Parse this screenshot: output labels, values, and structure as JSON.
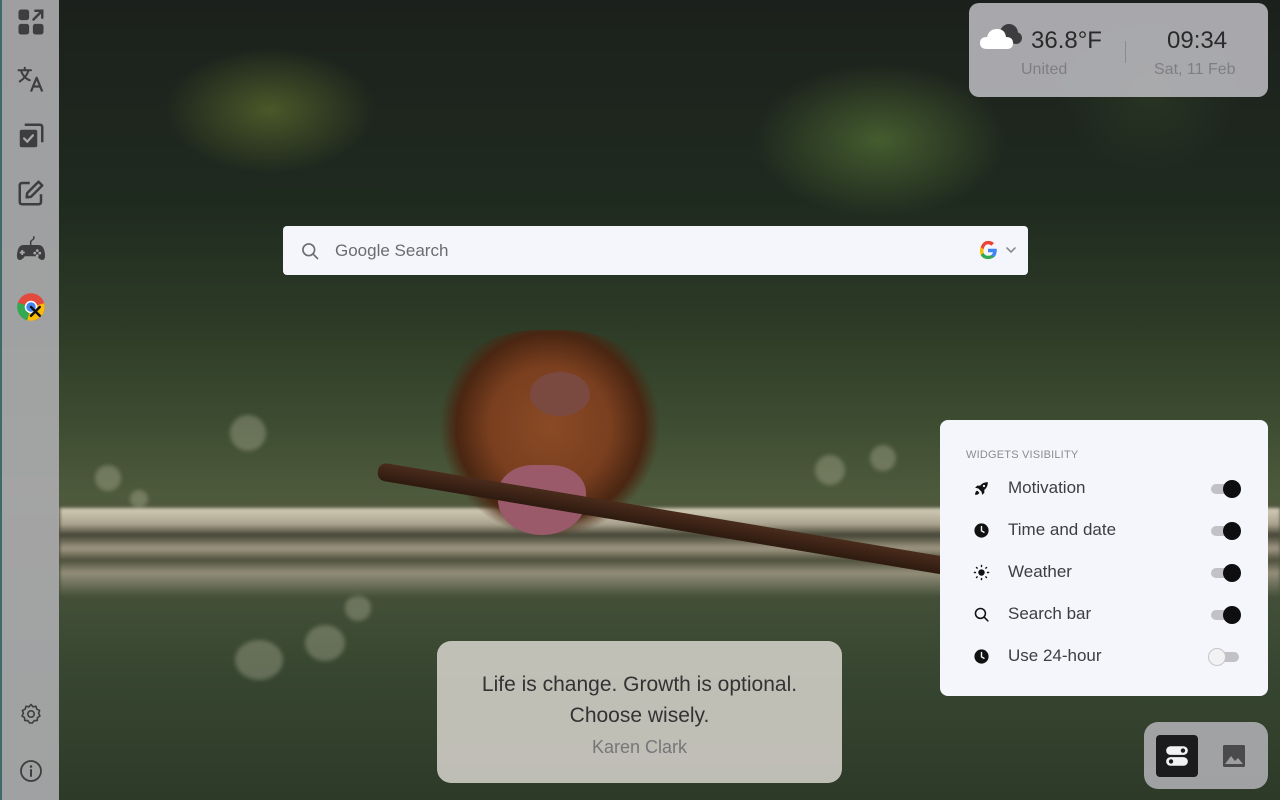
{
  "sidebar": {
    "items": [
      {
        "name": "dashboard",
        "icon": "apps-grid-arrow-icon"
      },
      {
        "name": "translate",
        "icon": "translate-icon"
      },
      {
        "name": "tasks",
        "icon": "checkbox-copy-icon"
      },
      {
        "name": "notes",
        "icon": "edit-note-icon"
      },
      {
        "name": "games",
        "icon": "gamepad-icon"
      },
      {
        "name": "chrome-tools",
        "icon": "chrome-tools-icon"
      }
    ],
    "bottom_items": [
      {
        "name": "settings",
        "icon": "gear-icon"
      },
      {
        "name": "about",
        "icon": "info-icon"
      }
    ]
  },
  "weather": {
    "icon": "cloudy-icon",
    "temperature": "36.8°F",
    "location": "United",
    "time": "09:34",
    "date": "Sat, 11 Feb"
  },
  "search": {
    "placeholder": "Google Search",
    "value": "",
    "engine": "Google",
    "engine_icon": "google-g-icon"
  },
  "widgets_panel": {
    "title": "WIDGETS VISIBILITY",
    "items": [
      {
        "label": "Motivation",
        "icon": "rocket-icon",
        "enabled": true
      },
      {
        "label": "Time and date",
        "icon": "clock-icon",
        "enabled": true
      },
      {
        "label": "Weather",
        "icon": "sun-icon",
        "enabled": true
      },
      {
        "label": "Search bar",
        "icon": "search-icon",
        "enabled": true
      },
      {
        "label": "Use 24-hour",
        "icon": "clock-icon",
        "enabled": false
      }
    ]
  },
  "quote": {
    "text": "Life is change. Growth is optional. Choose wisely.",
    "author": "Karen Clark"
  },
  "dock": {
    "items": [
      {
        "name": "widgets-toggle",
        "icon": "toggles-icon",
        "active": true
      },
      {
        "name": "wallpaper",
        "icon": "image-icon",
        "active": false
      }
    ]
  },
  "colors": {
    "toggle_on": "#0e0e10",
    "toggle_track": "#c2c2c6",
    "panel_bg": "#f5f6fb"
  }
}
